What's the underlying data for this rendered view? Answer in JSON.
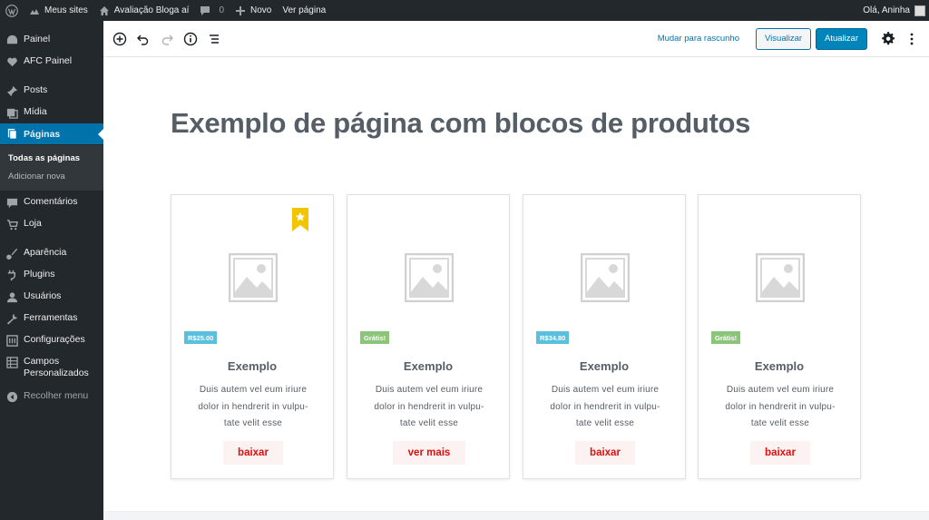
{
  "adminbar": {
    "my_sites": "Meus sites",
    "site_name": "Avaliação Bloga aí",
    "comments_count": "0",
    "new": "Novo",
    "view_page": "Ver página",
    "greeting": "Olá, Aninha"
  },
  "sidebar": {
    "items": {
      "painel": "Painel",
      "afc": "AFC Painel",
      "posts": "Posts",
      "midia": "Mídia",
      "paginas": "Páginas",
      "comentarios": "Comentários",
      "loja": "Loja",
      "aparencia": "Aparência",
      "plugins": "Plugins",
      "usuarios": "Usuários",
      "ferramentas": "Ferramentas",
      "configuracoes": "Configurações",
      "campos_line1": "Campos",
      "campos_line2": "Personalizados",
      "collapse": "Recolher menu"
    },
    "submenu": {
      "all_pages": "Todas as páginas",
      "add_new": "Adicionar nova"
    }
  },
  "toolbar": {
    "switch_draft": "Mudar para rascunho",
    "preview": "Visualizar",
    "update": "Atualizar"
  },
  "content": {
    "title": "Exemplo de página com blocos de produtos",
    "products": [
      {
        "price": "R$25.00",
        "title": "Exemplo",
        "desc1": "Duis autem vel eum iriure",
        "desc2": "dolor in hendrerit in vulpu-",
        "desc3": "tate velit esse",
        "button": "baixar"
      },
      {
        "price": "Grátis!",
        "title": "Exemplo",
        "desc1": "Duis autem vel eum iriure",
        "desc2": "dolor in hendrerit in vulpu-",
        "desc3": "tate velit esse",
        "button": "ver mais"
      },
      {
        "price": "R$34.80",
        "title": "Exemplo",
        "desc1": "Duis autem vel eum iriure",
        "desc2": "dolor in hendrerit in vulpu-",
        "desc3": "tate velit esse",
        "button": "baixar"
      },
      {
        "price": "Grátis!",
        "title": "Exemplo",
        "desc1": "Duis autem vel eum iriure",
        "desc2": "dolor in hendrerit in vulpu-",
        "desc3": "tate velit esse",
        "button": "baixar"
      }
    ]
  },
  "colors": {
    "admin_bg": "#23282d",
    "accent": "#0073aa",
    "price_paid": "#5bc0de",
    "price_free": "#8cc47a",
    "button_text": "#e10e0e",
    "bookmark": "#f2c500"
  }
}
